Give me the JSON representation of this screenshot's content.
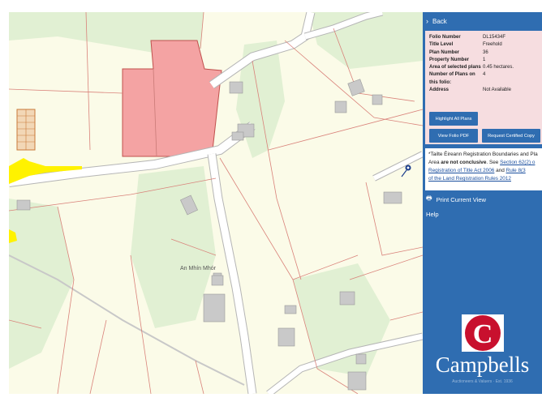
{
  "panel": {
    "back_label": "Back",
    "info": [
      {
        "key": "Folio Number",
        "value": "DL15434F"
      },
      {
        "key": "Title Level",
        "value": "Freehold"
      },
      {
        "key": "Plan Number",
        "value": "36"
      },
      {
        "key": "Property Number",
        "value": "1"
      },
      {
        "key": "Area of selected plans",
        "value": "0.45 hectares."
      },
      {
        "key": "Number of Plans on this folio:",
        "value": "4"
      },
      {
        "key": "Address",
        "value": "Not Available"
      }
    ],
    "buttons": {
      "highlight": "Highlight All Plans",
      "view_pdf": "View Folio PDF",
      "request_copy": "Request Certified Copy"
    },
    "note": {
      "line1": "*Tailte Éireann Registration Boundaries and Pla",
      "line2_pre": "Area ",
      "line2_bold": "are not conclusive",
      "line2_post": ". See ",
      "link1a": "Section 62(2) o",
      "link1b": "Registration of Title Act 2006",
      "mid": " and ",
      "link2a": "Rule 8(3",
      "link2b": "of the Land Registration Rules 2012"
    },
    "print_label": "Print Current View",
    "help_label": "Help",
    "logo_letter": "C",
    "logo_text": "Campbells",
    "logo_tagline": "Auctioneers & Valuers · Est. 1936"
  },
  "map": {
    "place_label": "An Mhín Mhór",
    "parcel_color": "#f4a3a3",
    "road_color": "#ffffff",
    "boundary_color": "#d9827a",
    "woodland_color": "#e1f0d3",
    "building_color": "#c9c9c9",
    "yellow_road_color": "#fff200"
  },
  "colors": {
    "panel_bg": "#2f6db1",
    "info_bg": "#f6dde0"
  }
}
